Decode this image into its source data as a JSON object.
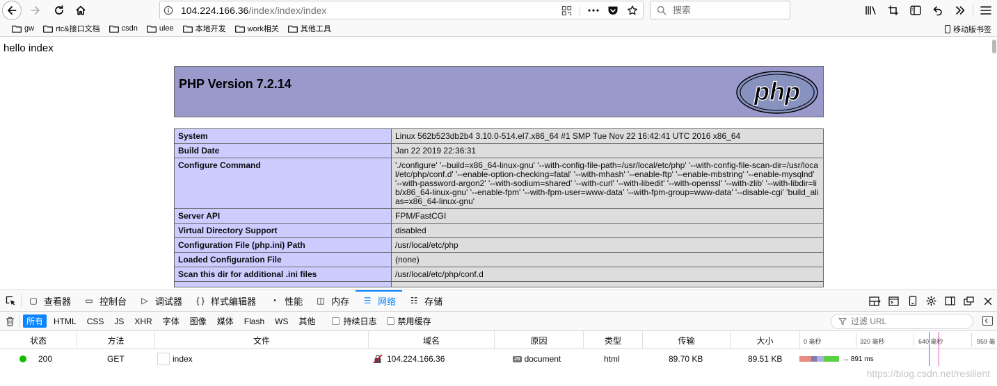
{
  "browser": {
    "url_host": "104.224.166.36",
    "url_path": "/index/index/index",
    "search_placeholder": "搜索"
  },
  "bookmarks": {
    "items": [
      "gw",
      "rtc&接口文档",
      "csdn",
      "ulee",
      "本地开发",
      "work相关",
      "其他工具"
    ],
    "mobile": "移动版书签"
  },
  "page": {
    "hello": "hello index",
    "php_version": "PHP Version 7.2.14",
    "logo_text": "php",
    "rows": [
      {
        "key": "System",
        "value": "Linux 562b523db2b4 3.10.0-514.el7.x86_64 #1 SMP Tue Nov 22 16:42:41 UTC 2016 x86_64"
      },
      {
        "key": "Build Date",
        "value": "Jan 22 2019 22:36:31"
      },
      {
        "key": "Configure Command",
        "value": "'./configure' '--build=x86_64-linux-gnu' '--with-config-file-path=/usr/local/etc/php' '--with-config-file-scan-dir=/usr/local/etc/php/conf.d' '--enable-option-checking=fatal' '--with-mhash' '--enable-ftp' '--enable-mbstring' '--enable-mysqlnd' '--with-password-argon2' '--with-sodium=shared' '--with-curl' '--with-libedit' '--with-openssl' '--with-zlib' '--with-libdir=lib/x86_64-linux-gnu' '--enable-fpm' '--with-fpm-user=www-data' '--with-fpm-group=www-data' '--disable-cgi' 'build_alias=x86_64-linux-gnu'"
      },
      {
        "key": "Server API",
        "value": "FPM/FastCGI"
      },
      {
        "key": "Virtual Directory Support",
        "value": "disabled"
      },
      {
        "key": "Configuration File (php.ini) Path",
        "value": "/usr/local/etc/php"
      },
      {
        "key": "Loaded Configuration File",
        "value": "(none)"
      },
      {
        "key": "Scan this dir for additional .ini files",
        "value": "/usr/local/etc/php/conf.d"
      },
      {
        "key": "",
        "value": ""
      }
    ]
  },
  "devtools": {
    "tabs": [
      {
        "label": "查看器",
        "icon": "inspector-icon"
      },
      {
        "label": "控制台",
        "icon": "console-icon"
      },
      {
        "label": "调试器",
        "icon": "debugger-icon"
      },
      {
        "label": "样式编辑器",
        "icon": "style-editor-icon"
      },
      {
        "label": "性能",
        "icon": "performance-icon"
      },
      {
        "label": "内存",
        "icon": "memory-icon"
      },
      {
        "label": "网络",
        "icon": "network-icon",
        "active": true
      },
      {
        "label": "存储",
        "icon": "storage-icon"
      }
    ],
    "filters": [
      "所有",
      "HTML",
      "CSS",
      "JS",
      "XHR",
      "字体",
      "图像",
      "媒体",
      "Flash",
      "WS",
      "其他"
    ],
    "persist_logs": "持续日志",
    "disable_cache": "禁用缓存",
    "filter_placeholder": "过滤 URL",
    "columns": [
      "状态",
      "方法",
      "文件",
      "域名",
      "原因",
      "类型",
      "传输",
      "大小"
    ],
    "waterfall_ticks": [
      "0 毫秒",
      "320 毫秒",
      "640 毫秒",
      "959 毫"
    ],
    "request": {
      "status": "200",
      "method": "GET",
      "file": "index",
      "domain": "104.224.166.36",
      "cause_badge": "JS",
      "cause": "document",
      "type": "html",
      "transferred": "89.70 KB",
      "size": "89.51 KB",
      "timing": "→ 891 ms"
    }
  },
  "watermark": "https://blog.csdn.net/resilient"
}
